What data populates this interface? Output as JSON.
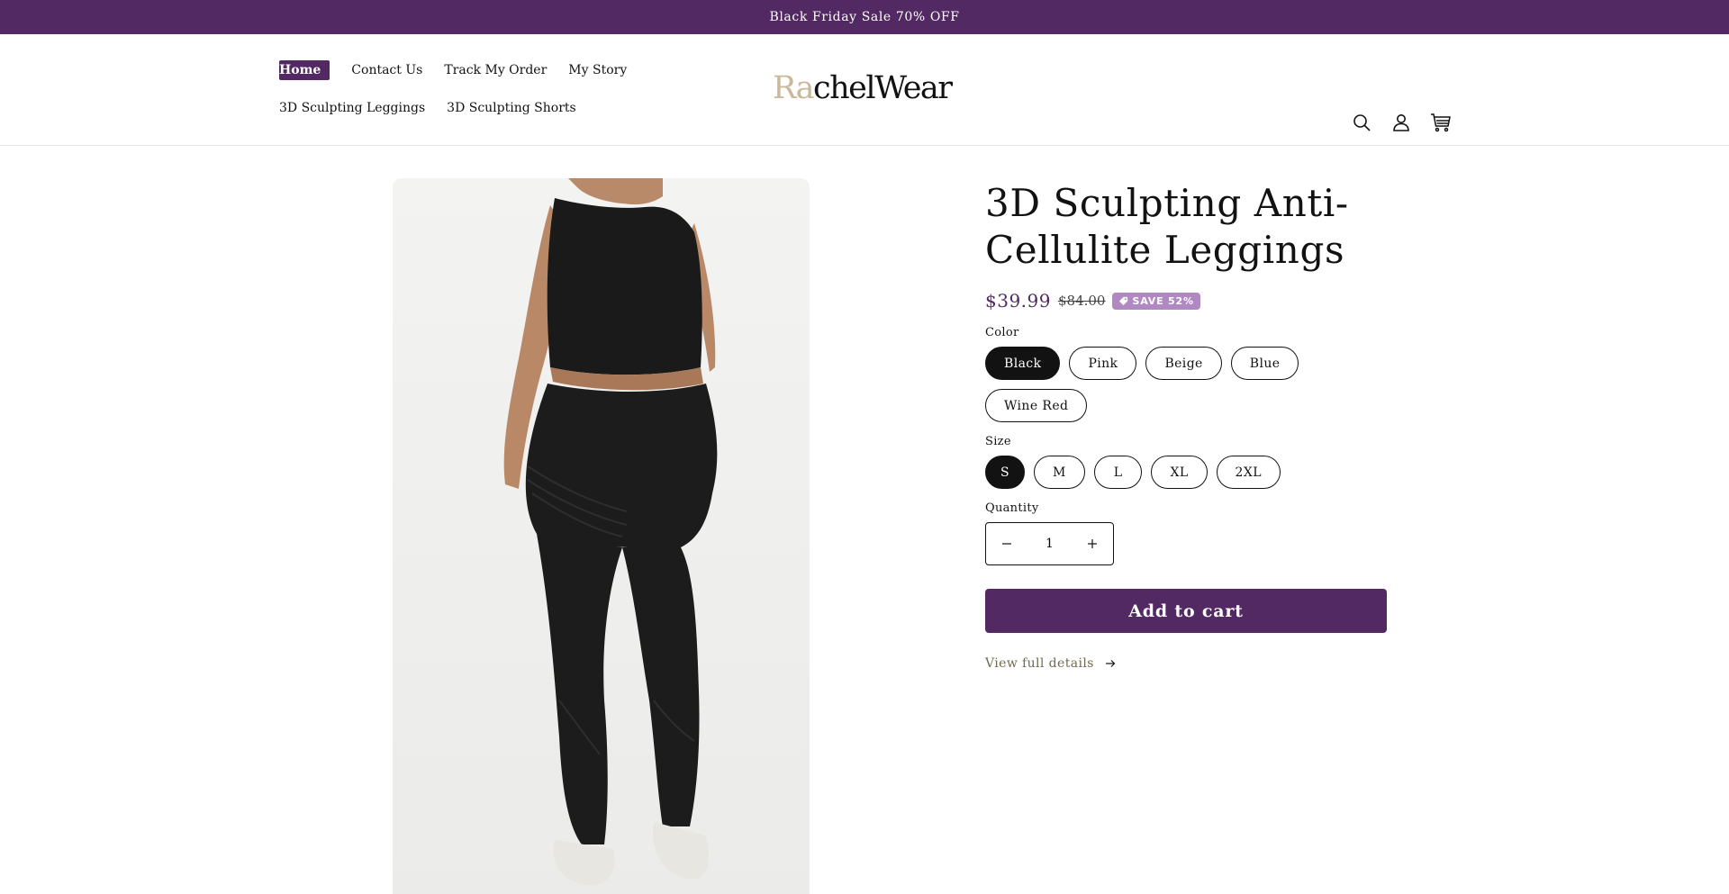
{
  "announcement": {
    "text": "Black Friday Sale 70% OFF"
  },
  "header": {
    "nav_row1": [
      "Home",
      "Contact Us",
      "Track My Order",
      "My Story"
    ],
    "nav_row2": [
      "3D Sculpting Leggings",
      "3D Sculpting Shorts"
    ],
    "logo_part1": "Ra",
    "logo_part2": "chelWear",
    "icons": [
      "search-icon",
      "account-icon",
      "cart-icon"
    ]
  },
  "product": {
    "title": "3D Sculpting Anti-Cellulite Leggings",
    "price_sale": "$39.99",
    "price_compare": "$84.00",
    "save_badge": "SAVE 52%",
    "color_label": "Color",
    "colors": [
      "Black",
      "Pink",
      "Beige",
      "Blue",
      "Wine Red"
    ],
    "selected_color": "Black",
    "size_label": "Size",
    "sizes": [
      "S",
      "M",
      "L",
      "XL",
      "2XL"
    ],
    "selected_size": "S",
    "quantity_label": "Quantity",
    "quantity_value": "1",
    "add_to_cart": "Add to cart",
    "view_details": "View full details"
  },
  "colors": {
    "brand": "#522962",
    "badge": "#b088c2",
    "price": "#522962",
    "link": "#6e6b4f"
  }
}
